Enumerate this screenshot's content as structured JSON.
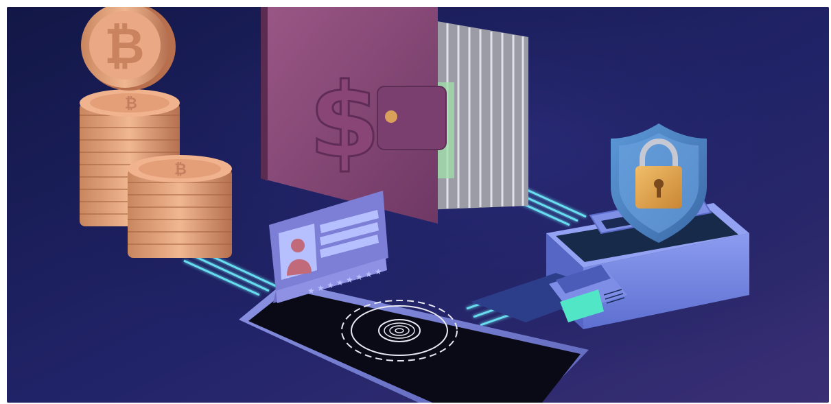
{
  "image": {
    "description_colors": {
      "bg_top": "#151a52",
      "bg_bottom": "#2b2a6e",
      "bg_right": "#3a2f74",
      "glow": "#6ff2ff",
      "coin": "#e3a07c",
      "coin_dark": "#b06a4a",
      "wallet": "#8a4a78",
      "wallet_dark": "#6a3560",
      "cash": "#bfbfc6",
      "cash_green": "#9fe0a8",
      "card": "#8e93e8",
      "card_light": "#b7c0ff",
      "phone_frame": "#7c84d6",
      "phone_screen": "#0b0b18",
      "shield": "#4e86c6",
      "lock": "#e2a24a",
      "box": "#7b8ce3",
      "box_dark": "#5a6bc8",
      "teal": "#50e6c6"
    },
    "icons": [
      "bitcoin-coin-icon",
      "wallet-dollar-icon",
      "shield-lock-icon",
      "id-card-icon",
      "fingerprint-icon",
      "card-reader-icon"
    ]
  }
}
